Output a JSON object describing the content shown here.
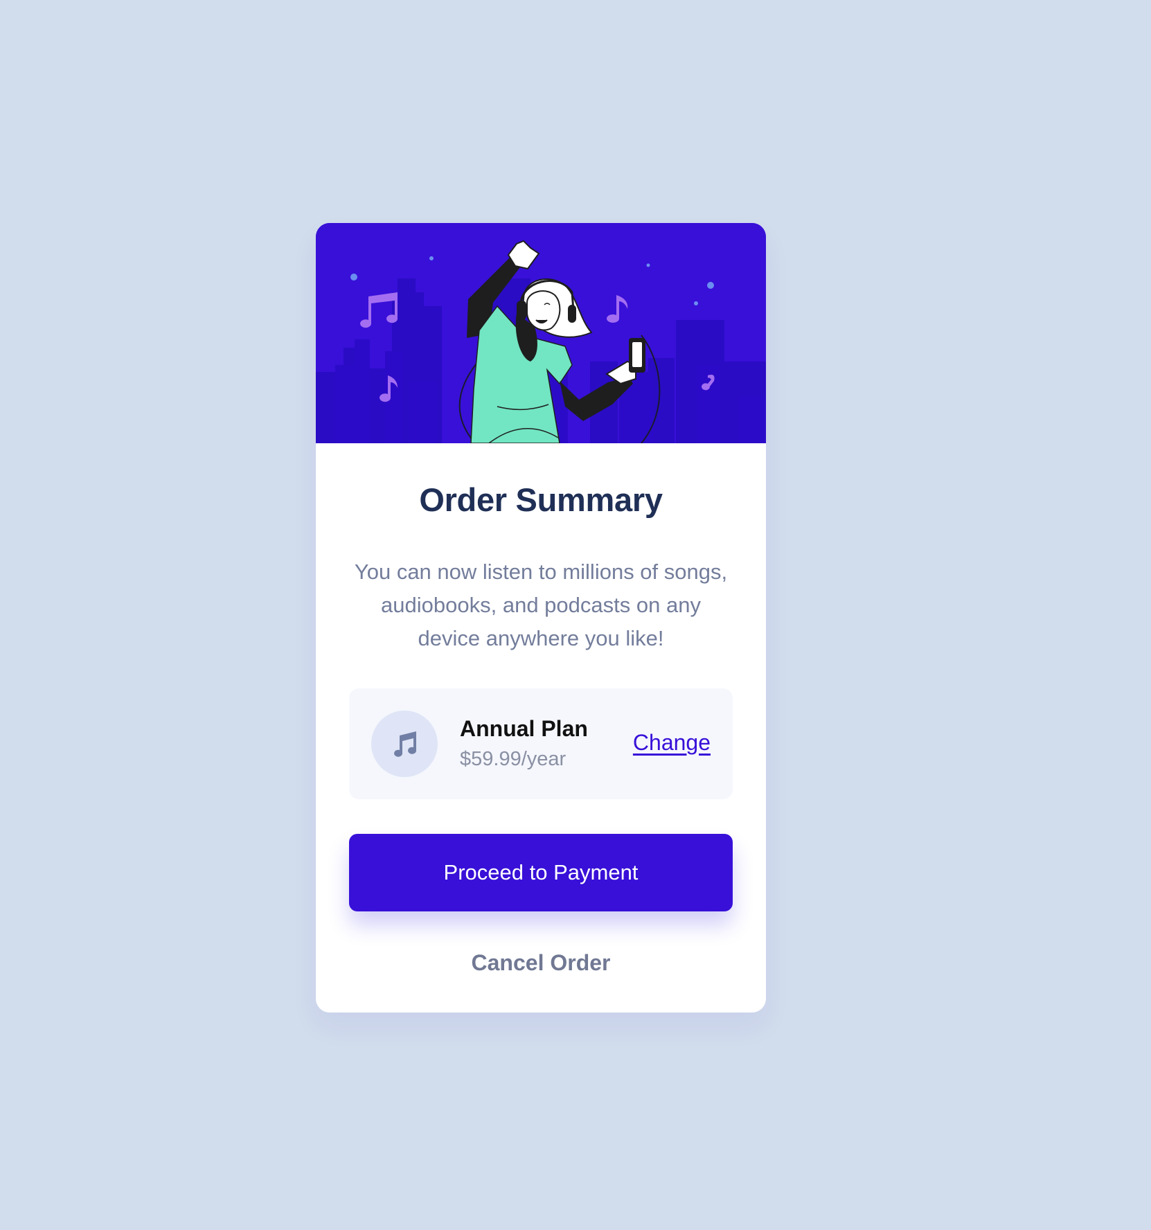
{
  "card": {
    "title": "Order Summary",
    "description": "You can now listen to millions of songs, audiobooks, and podcasts on any device anywhere you like!",
    "hero_illustration": "person-dancing-with-headphones-illustration"
  },
  "plan": {
    "icon": "music-note-icon",
    "name": "Annual Plan",
    "price": "$59.99/year",
    "change_label": "Change"
  },
  "actions": {
    "proceed_label": "Proceed to Payment",
    "cancel_label": "Cancel Order"
  },
  "colors": {
    "page_background": "#d1dcec",
    "accent": "#3810d8",
    "title": "#1f2f56",
    "body_text": "#737d9b"
  }
}
